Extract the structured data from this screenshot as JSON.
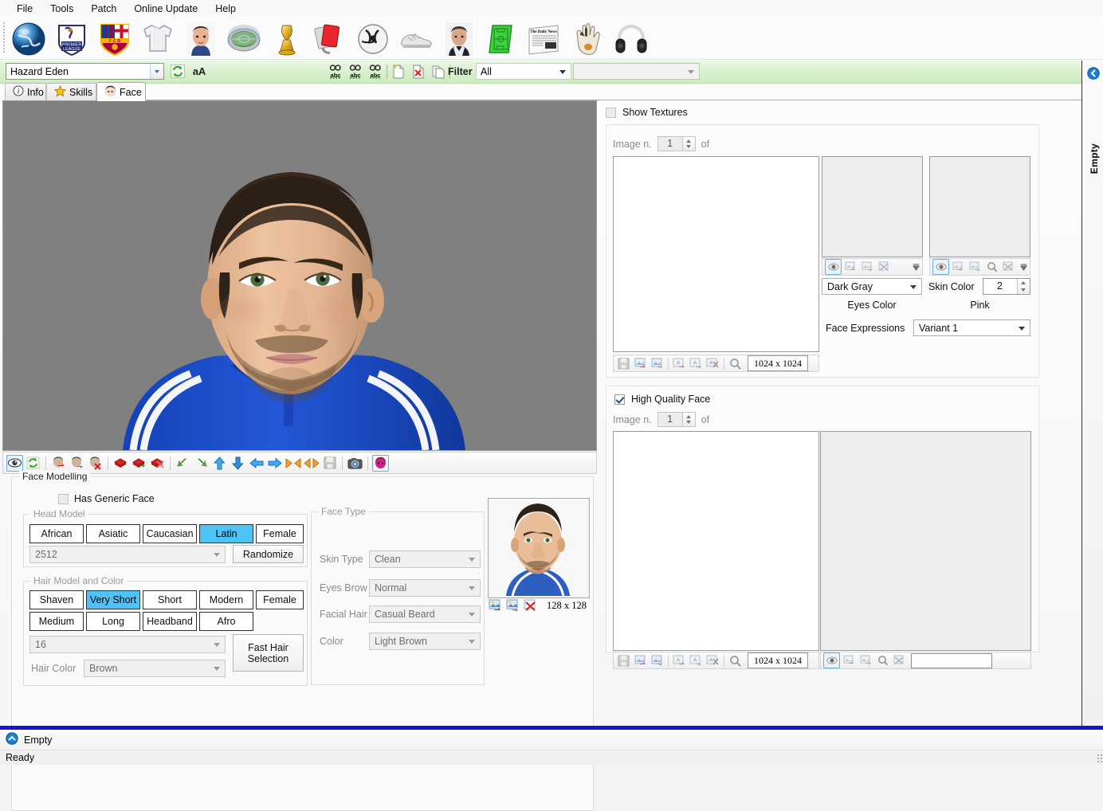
{
  "menu": {
    "items": [
      "File",
      "Tools",
      "Patch",
      "Online Update",
      "Help"
    ]
  },
  "big_toolbar": {
    "items": [
      {
        "name": "globe-icon",
        "title": "World"
      },
      {
        "name": "premier-league-shield-icon",
        "title": "Leagues"
      },
      {
        "name": "club-crest-icon",
        "title": "Teams"
      },
      {
        "name": "jersey-icon",
        "title": "Kits"
      },
      {
        "name": "player-portrait-icon",
        "title": "Players"
      },
      {
        "name": "stadium-icon",
        "title": "Stadiums"
      },
      {
        "name": "trophy-icon",
        "title": "Trophies"
      },
      {
        "name": "cards-icon",
        "title": "Cards"
      },
      {
        "name": "ball-icon",
        "title": "Balls"
      },
      {
        "name": "boot-icon",
        "title": "Boots"
      },
      {
        "name": "manager-portrait-icon",
        "title": "Staff"
      },
      {
        "name": "pitch-book-icon",
        "title": "Tactics"
      },
      {
        "name": "newspaper-icon",
        "title": "News"
      },
      {
        "name": "goalkeeper-glove-icon",
        "title": "Gloves"
      },
      {
        "name": "headphones-icon",
        "title": "Audio"
      }
    ]
  },
  "filter_bar": {
    "name_value": "Hazard Eden",
    "refresh_icon": "refresh-icon",
    "case_button_label": "aA",
    "mini_icons": [
      "find-abc-icon",
      "find-next-abc-icon",
      "find-prev-abc-icon",
      "new-record-icon",
      "delete-record-icon",
      "duplicate-record-icon"
    ],
    "filter_label": "Filter",
    "filter_value": "All",
    "secondary_value": ""
  },
  "tabs": [
    {
      "label": "Info",
      "icon": "info-icon",
      "active": false
    },
    {
      "label": "Skills",
      "icon": "star-icon",
      "active": false
    },
    {
      "label": "Face",
      "icon": "face-icon",
      "active": true
    }
  ],
  "viewport": {
    "background_color": "#808080",
    "toolbar": [
      {
        "name": "eye-preview-icon",
        "selected": true
      },
      {
        "name": "refresh-model-icon",
        "selected": false
      },
      {
        "name": "head-import-red-icon",
        "selected": false
      },
      {
        "name": "head-export-green-icon",
        "selected": false
      },
      {
        "name": "head-delete-icon",
        "selected": false
      },
      {
        "name": "mesh-import-red-icon",
        "selected": false
      },
      {
        "name": "mesh-export-green-icon",
        "selected": false
      },
      {
        "name": "mesh-delete-icon",
        "selected": false
      },
      {
        "name": "rotate-back-left-icon",
        "selected": false
      },
      {
        "name": "rotate-back-right-icon",
        "selected": false
      },
      {
        "name": "move-up-icon",
        "selected": false
      },
      {
        "name": "move-down-icon",
        "selected": false
      },
      {
        "name": "move-left-icon",
        "selected": false
      },
      {
        "name": "move-right-icon",
        "selected": false
      },
      {
        "name": "shrink-horizontal-icon",
        "selected": false
      },
      {
        "name": "expand-horizontal-icon",
        "selected": false
      },
      {
        "name": "save-icon",
        "selected": false
      },
      {
        "name": "camera-snapshot-icon",
        "selected": false
      },
      {
        "name": "face-preview-icon",
        "selected": true
      }
    ]
  },
  "face_modelling": {
    "title": "Face Modelling",
    "has_generic_face": {
      "label": "Has Generic Face",
      "checked": false
    },
    "head_model": {
      "title": "Head Model",
      "buttons": [
        "African",
        "Asiatic",
        "Caucasian",
        "Latin",
        "Female"
      ],
      "selected": "Latin",
      "model_id": "2512",
      "randomize_label": "Randomize"
    },
    "hair_model": {
      "title": "Hair Model and Color",
      "buttons_row1": [
        "Shaven",
        "Very Short",
        "Short",
        "Modern",
        "Female"
      ],
      "buttons_row2": [
        "Medium",
        "Long",
        "Headband",
        "Afro"
      ],
      "selected": "Very Short",
      "hair_id": "16",
      "fast_hair_label": "Fast Hair\nSelection",
      "fast_hair_line1": "Fast Hair",
      "fast_hair_line2": "Selection",
      "hair_color_label": "Hair Color",
      "hair_color_value": "Brown"
    },
    "face_type": {
      "title": "Face Type",
      "rows": [
        {
          "label": "Skin Type",
          "value": "Clean"
        },
        {
          "label": "Eyes Brow",
          "value": "Normal"
        },
        {
          "label": "Facial Hair",
          "value": "Casual Beard"
        },
        {
          "label": "Color",
          "value": "Light Brown"
        }
      ]
    },
    "preview": {
      "size_label": "128 x 128",
      "icons": [
        "import-image-red-icon",
        "export-image-green-icon",
        "delete-image-icon"
      ]
    }
  },
  "textures": {
    "show_textures": {
      "label": "Show Textures",
      "checked": false
    },
    "image_n_label": "Image n.",
    "image_n_value": "1",
    "of_label": "of",
    "main_toolbar": [
      {
        "name": "save-texture-icon"
      },
      {
        "name": "import-texture-icon"
      },
      {
        "name": "export-texture-icon"
      },
      {
        "name": "import-alpha-icon"
      },
      {
        "name": "export-alpha-icon"
      },
      {
        "name": "delete-alpha-icon"
      },
      {
        "name": "zoom-texture-icon"
      }
    ],
    "main_size": "1024 x 1024",
    "eyes_toolbar": [
      {
        "name": "eye-preview-icon",
        "selected": true
      },
      {
        "name": "import-eye-icon",
        "selected": false
      },
      {
        "name": "export-eye-icon",
        "selected": false
      },
      {
        "name": "delete-eye-icon",
        "selected": false
      }
    ],
    "pink_toolbar": [
      {
        "name": "eye-preview-icon",
        "selected": true
      },
      {
        "name": "import-pink-icon",
        "selected": false
      },
      {
        "name": "export-pink-icon",
        "selected": false
      },
      {
        "name": "zoom-pink-icon",
        "selected": false
      },
      {
        "name": "delete-pink-icon",
        "selected": false
      }
    ],
    "eyes_color_value": "Dark Gray",
    "eyes_color_label": "Eyes Color",
    "skin_color_label": "Skin Color",
    "skin_color_value": "2",
    "pink_label": "Pink",
    "face_expressions_label": "Face Expressions",
    "face_expressions_value": "Variant 1"
  },
  "high_quality_face": {
    "checkbox": {
      "label": "High Quality Face",
      "checked": true
    },
    "image_n_label": "Image n.",
    "image_n_value": "1",
    "of_label": "of",
    "main_toolbar": [
      {
        "name": "save-texture-icon"
      },
      {
        "name": "import-texture-icon"
      },
      {
        "name": "export-texture-icon"
      },
      {
        "name": "import-alpha-icon"
      },
      {
        "name": "export-alpha-icon"
      },
      {
        "name": "delete-alpha-icon"
      },
      {
        "name": "zoom-texture-icon"
      }
    ],
    "main_size": "1024 x 1024",
    "side_toolbar": [
      {
        "name": "eye-preview-icon",
        "selected": true
      },
      {
        "name": "import-hq-icon",
        "selected": false
      },
      {
        "name": "export-hq-icon",
        "selected": false
      },
      {
        "name": "zoom-hq-icon",
        "selected": false
      },
      {
        "name": "delete-hq-icon",
        "selected": false
      }
    ],
    "side_field_value": ""
  },
  "dock": {
    "label": "Empty",
    "icon": "back-arrow-icon"
  },
  "bottom": {
    "empty_label": "Empty",
    "empty_icon": "up-arrow-icon"
  },
  "status": {
    "text": "Ready"
  },
  "colors": {
    "accent_selected": "#4fc3f7",
    "green_bar": "#d8f0cd",
    "blue_line": "#1414d2",
    "viewport_bg": "#808080"
  }
}
